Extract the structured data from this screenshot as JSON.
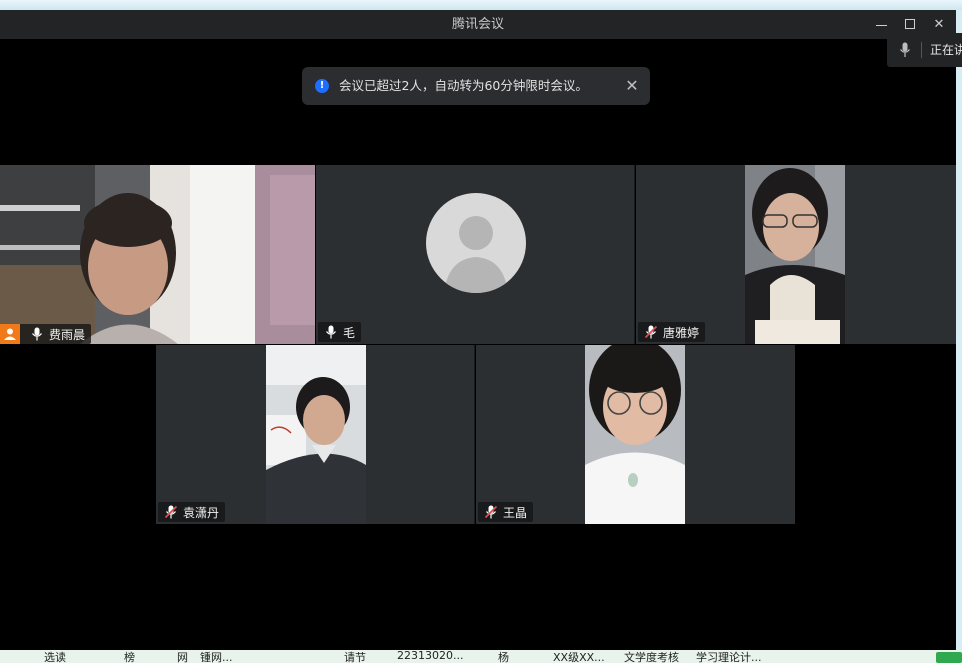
{
  "window": {
    "title": "腾讯会议",
    "speaking_label": "正在讲"
  },
  "notification": {
    "message": "会议已超过2人，自动转为60分钟限时会议。"
  },
  "participants": [
    {
      "name": "费雨晨",
      "mic": "on",
      "host": true,
      "active": true,
      "video": true
    },
    {
      "name": "毛",
      "mic": "on",
      "host": false,
      "active": false,
      "video": false
    },
    {
      "name": "唐雅婷",
      "mic": "muted",
      "host": false,
      "active": false,
      "video": true
    },
    {
      "name": "袁潇丹",
      "mic": "muted",
      "host": false,
      "active": false,
      "video": true
    },
    {
      "name": "王晶",
      "mic": "muted",
      "host": false,
      "active": false,
      "video": true
    }
  ],
  "taskbar": {
    "items": [
      "选读",
      "榜",
      "网",
      "锺网...",
      "请节",
      "22313020...",
      "杨",
      "XX级XX...",
      "文学度考核",
      "学习理论计..."
    ]
  },
  "colors": {
    "active_border": "#19b35c",
    "host_badge": "#f07a1a",
    "muted_mic": "#e5484d",
    "info_icon": "#1e6fff"
  },
  "icons": {
    "minimize": "minimize-icon",
    "maximize": "maximize-icon",
    "close": "close-icon",
    "mic_on": "microphone-icon",
    "mic_muted": "microphone-muted-icon",
    "host": "host-user-icon",
    "avatar": "default-avatar-icon"
  }
}
